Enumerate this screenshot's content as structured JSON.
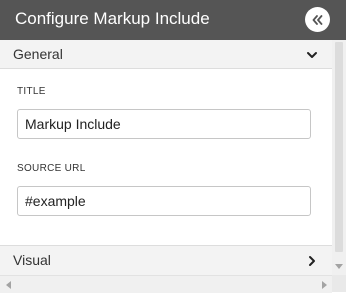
{
  "header": {
    "title": "Configure Markup Include",
    "collapse_icon": "double-chevron-left-icon"
  },
  "sections": {
    "general": {
      "label": "General",
      "expanded": true,
      "chevron_icon": "chevron-down-icon"
    },
    "visual": {
      "label": "Visual",
      "expanded": false,
      "chevron_icon": "chevron-right-icon"
    }
  },
  "fields": {
    "title": {
      "label": "TITLE",
      "value": "Markup Include"
    },
    "source_url": {
      "label": "SOURCE URL",
      "value": "#example"
    }
  },
  "colors": {
    "header_bg": "#555555",
    "section_bg": "#f3f3f3",
    "input_border": "#c6c6c6"
  }
}
